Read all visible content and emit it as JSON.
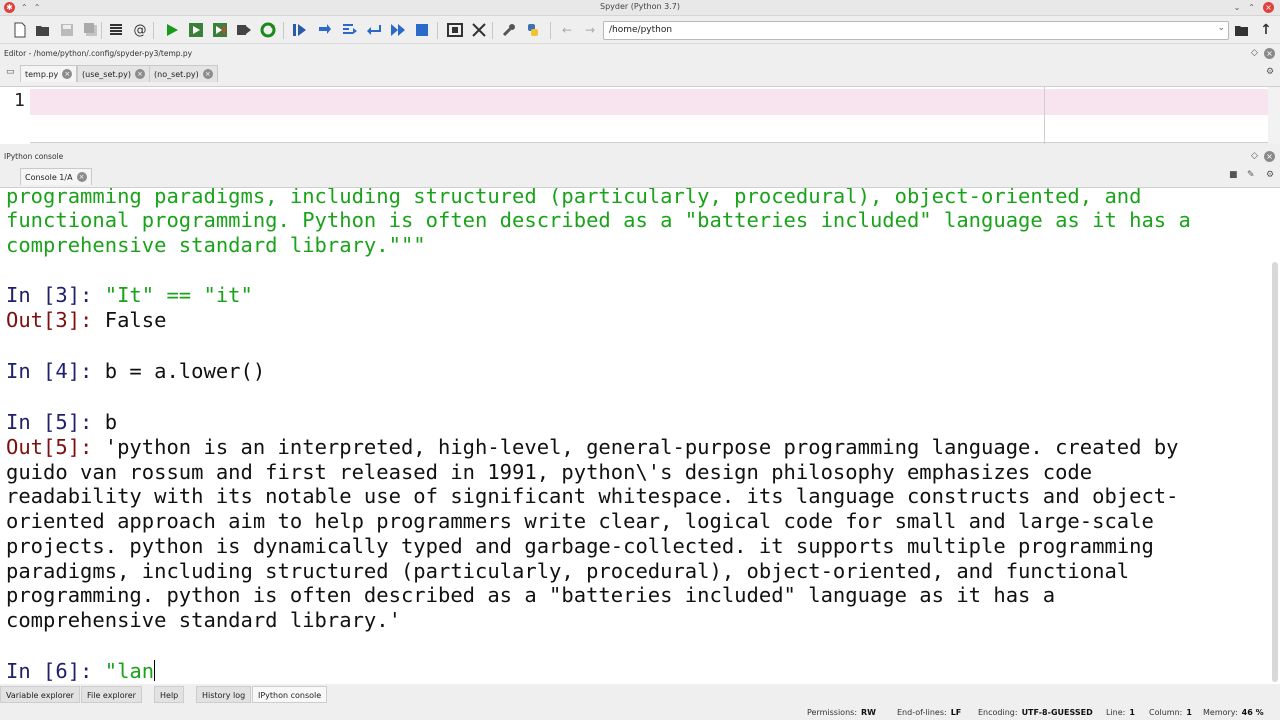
{
  "window": {
    "title": "Spyder (Python 3.7)"
  },
  "toolbar": {
    "path": "/home/python"
  },
  "editor": {
    "header": "Editor - /home/python/.config/spyder-py3/temp.py",
    "tabs": [
      "temp.py",
      "(use_set.py)",
      "(no_set.py)"
    ],
    "line_number": "1"
  },
  "console": {
    "header": "IPython console",
    "tab": "Console 1/A",
    "lines": {
      "g1": "programming paradigms, including structured (particularly, procedural), object-oriented, and",
      "g2": "functional programming. Python is often described as a \"batteries included\" language as it has a",
      "g3": "comprehensive standard library.\"\"\"",
      "in3_prompt": "In [3]: ",
      "in3_code": "\"It\" == \"it\"",
      "out3_prompt": "Out[3]: ",
      "out3_value": "False",
      "in4_prompt": "In [4]: ",
      "in4_code": "b = a.lower()",
      "in5_prompt": "In [5]: ",
      "in5_code": "b",
      "out5_prompt": "Out[5]: ",
      "o1": "'python is an interpreted, high-level, general-purpose programming language. created by",
      "o2": "guido van rossum and first released in 1991, python\\'s design philosophy emphasizes code",
      "o3": "readability with its notable use of significant whitespace. its language constructs and object-",
      "o4": "oriented approach aim to help programmers write clear, logical code for small and large-scale",
      "o5": "projects. python is dynamically typed and garbage-collected. it supports multiple programming",
      "o6": "paradigms, including structured (particularly, procedural), object-oriented, and functional",
      "o7": "programming. python is often described as a \"batteries included\" language as it has a",
      "o8": "comprehensive standard library.'",
      "in6_prompt": "In [6]: ",
      "in6_code": "\"lan"
    }
  },
  "bottom_tabs": [
    "Variable explorer",
    "File explorer",
    "Help",
    "History log",
    "IPython console"
  ],
  "status": {
    "permissions_label": "Permissions:",
    "permissions_value": "RW",
    "eol_label": "End-of-lines:",
    "eol_value": "LF",
    "encoding_label": "Encoding:",
    "encoding_value": "UTF-8-GUESSED",
    "line_label": "Line:",
    "line_value": "1",
    "column_label": "Column:",
    "column_value": "1",
    "memory_label": "Memory:",
    "memory_value": "46 %"
  },
  "colors": {
    "prompt_in": "#1f1f6e",
    "prompt_out": "#7a1010",
    "string_green": "#1aa31a",
    "current_line": "#f7e4ef"
  }
}
